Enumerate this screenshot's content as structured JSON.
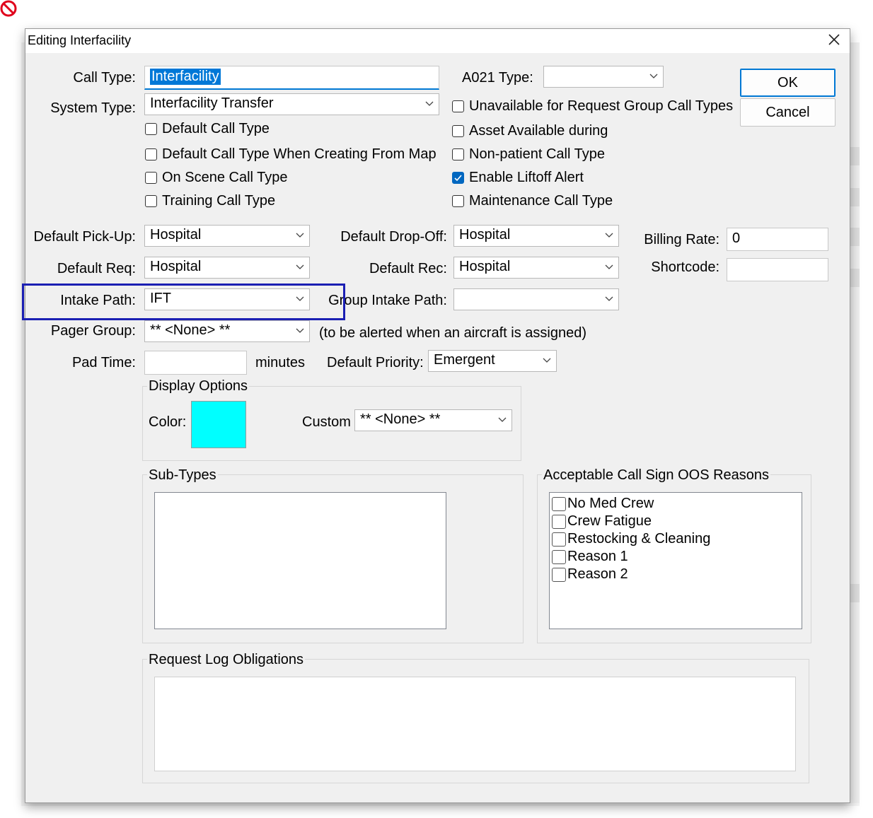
{
  "dialog": {
    "title": "Editing Interfacility",
    "close_icon": "close-icon"
  },
  "fields": {
    "call_type": {
      "label": "Call Type:",
      "value": "Interfacility"
    },
    "a021_type": {
      "label": "A021 Type:",
      "value": ""
    },
    "system_type": {
      "label": "System Type:",
      "value": "Interfacility Transfer"
    },
    "default_pickup": {
      "label": "Default Pick-Up:",
      "value": "Hospital"
    },
    "default_dropoff": {
      "label": "Default Drop-Off:",
      "value": "Hospital"
    },
    "billing_rate": {
      "label": "Billing Rate:",
      "value": "0"
    },
    "default_req": {
      "label": "Default Req:",
      "value": "Hospital"
    },
    "default_rec": {
      "label": "Default Rec:",
      "value": "Hospital"
    },
    "shortcode": {
      "label": "Shortcode:",
      "value": ""
    },
    "intake_path": {
      "label": "Intake Path:",
      "value": "IFT"
    },
    "group_intake_path": {
      "label": "Group Intake Path:",
      "value": ""
    },
    "pager_group": {
      "label": "Pager Group:",
      "value": "** <None> **",
      "note": "(to be alerted when an aircraft is assigned)"
    },
    "pad_time": {
      "label": "Pad Time:",
      "value": "",
      "unit": "minutes"
    },
    "default_priority": {
      "label": "Default Priority:",
      "value": "Emergent"
    }
  },
  "checkboxes_left": [
    {
      "label": "Default Call Type",
      "checked": false
    },
    {
      "label": "Default Call Type When Creating From Map",
      "checked": false
    },
    {
      "label": "On Scene Call Type",
      "checked": false
    },
    {
      "label": "Training Call Type",
      "checked": false
    }
  ],
  "checkboxes_right": [
    {
      "label": "Unavailable for Request Group Call Types",
      "checked": false
    },
    {
      "label": "Asset Available during",
      "checked": false
    },
    {
      "label": "Non-patient Call Type",
      "checked": false
    },
    {
      "label": "Enable Liftoff Alert",
      "checked": true
    },
    {
      "label": "Maintenance Call Type",
      "checked": false
    }
  ],
  "buttons": {
    "ok": "OK",
    "cancel": "Cancel"
  },
  "display_options": {
    "title": "Display Options",
    "color_label": "Color:",
    "color_value": "#00ffff",
    "custom_label": "Custom",
    "custom_value": "** <None> **"
  },
  "sub_types": {
    "title": "Sub-Types"
  },
  "oos_reasons": {
    "title": "Acceptable Call Sign OOS Reasons",
    "items": [
      {
        "label": "No Med Crew",
        "checked": false
      },
      {
        "label": "Crew Fatigue",
        "checked": false
      },
      {
        "label": "Restocking & Cleaning",
        "checked": false
      },
      {
        "label": "Reason 1",
        "checked": false
      },
      {
        "label": "Reason 2",
        "checked": false
      }
    ]
  },
  "request_log": {
    "title": "Request Log Obligations"
  },
  "colors": {
    "highlight_box": "#1b1fb3",
    "accent": "#0078d4",
    "check": "#0067c0"
  }
}
